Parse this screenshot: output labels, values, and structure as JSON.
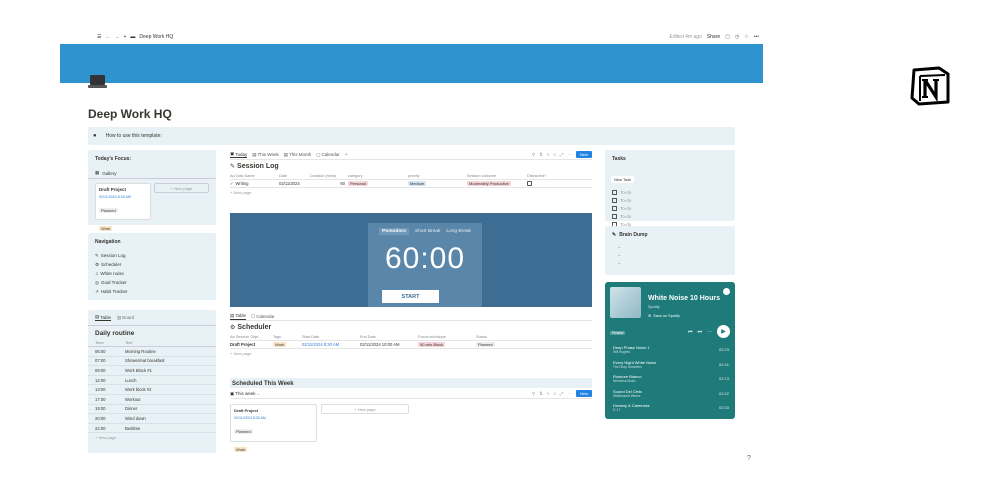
{
  "breadcrumb": {
    "page": "Deep Work HQ"
  },
  "topbar": {
    "edited": "Edited 4m ago",
    "share": "Share"
  },
  "page": {
    "title": "Deep Work HQ",
    "callout": "How to use this template:"
  },
  "focus": {
    "title": "Today's Focus:",
    "view": "Gallery",
    "card_title": "Draft Project",
    "card_date": "02/11/2024 8:30 AM",
    "card_status": "Planned",
    "card_tag": "Work",
    "new_page": "+ New page"
  },
  "navigation": {
    "title": "Navigation",
    "items": [
      "Session Log",
      "Scheduler",
      "White noise",
      "Goal Tracker",
      "Habit Tracker"
    ]
  },
  "routine": {
    "tab_table": "Table",
    "tab_board": "Board",
    "title": "Daily routine",
    "col_time": "Time",
    "col_text": "Text",
    "rows": [
      [
        "06:00",
        "Morning Routine"
      ],
      [
        "07:00",
        "Shower/eat breakfast"
      ],
      [
        "09:00",
        "Work Block #1"
      ],
      [
        "12:00",
        "Lunch"
      ],
      [
        "13:00",
        "Work block #2"
      ],
      [
        "17:00",
        "Workout"
      ],
      [
        "19:00",
        "Dinner"
      ],
      [
        "20:00",
        "Wind down"
      ],
      [
        "22:00",
        "Bedtime"
      ]
    ],
    "new_page": "+ New page"
  },
  "session": {
    "tabs": [
      "Today",
      "This Week",
      "This Month",
      "Calendar"
    ],
    "new": "New",
    "title": "Session Log",
    "cols": [
      "Aa Task Name",
      "Date",
      "Duration (mins)",
      "category",
      "priority",
      "Session outcome",
      "Distracted?"
    ],
    "row": {
      "name": "Writing",
      "date": "02/11/2024",
      "duration": "60",
      "category": "Personal",
      "priority": "Medium",
      "outcome": "Moderately Productive"
    },
    "new_page": "+ New page"
  },
  "pomodoro": {
    "tabs": [
      "Pomodoro",
      "Short Break",
      "Long Break"
    ],
    "time": "60:00",
    "start": "START"
  },
  "scheduler": {
    "tab_table": "Table",
    "tab_calendar": "Calendar",
    "title": "Scheduler",
    "cols": [
      "Aa Session Obje...",
      "Tags",
      "Start Date",
      "End Date",
      "Focus technique",
      "Status"
    ],
    "row": {
      "name": "Draft Project",
      "tag": "Work",
      "start": "02/11/2024 8:30 AM",
      "end": "02/11/2024 10:00 AM",
      "technique": "90-min Block",
      "status": "Planned"
    },
    "new_page": "+ New page"
  },
  "week": {
    "title": "Scheduled This Week",
    "view": "This week",
    "new": "New",
    "card_title": "Draft Project",
    "card_date": "02/11/2024 8:30 AM",
    "card_status": "Planned",
    "card_tag": "Work",
    "new_page": "+ New page"
  },
  "tasks": {
    "title": "Tasks",
    "new_task": "New Task",
    "items": [
      "To-do",
      "To-do",
      "To-do",
      "To-do",
      "To-do"
    ]
  },
  "braindump": {
    "title": "Brain Dump",
    "lines": [
      "–",
      "–",
      "–"
    ]
  },
  "spotify": {
    "title": "White Noise 10 Hours",
    "artist": "Spotify",
    "save": "Save on Spotify",
    "preview": "Preview",
    "tracks": [
      [
        "Deep Phase Noise 1",
        "Will Hughes",
        "02:23"
      ],
      [
        "Every Night White Noise",
        "The Deep Dreamers",
        "02:41"
      ],
      [
        "Ruimore Bianco",
        "Nebulosa Music",
        "02:13"
      ],
      [
        "Sound Del Cielo",
        "Whitesound Waves",
        "02:22"
      ],
      [
        "Dreamy & Calmness",
        "D.J.T",
        "02:33"
      ]
    ]
  },
  "colors": {
    "cover": "#2f93cf",
    "callout": "#e8f1f6",
    "pomodoro": "#3e6d94",
    "spotify": "#1f7a7a",
    "accent": "#2383e2"
  }
}
